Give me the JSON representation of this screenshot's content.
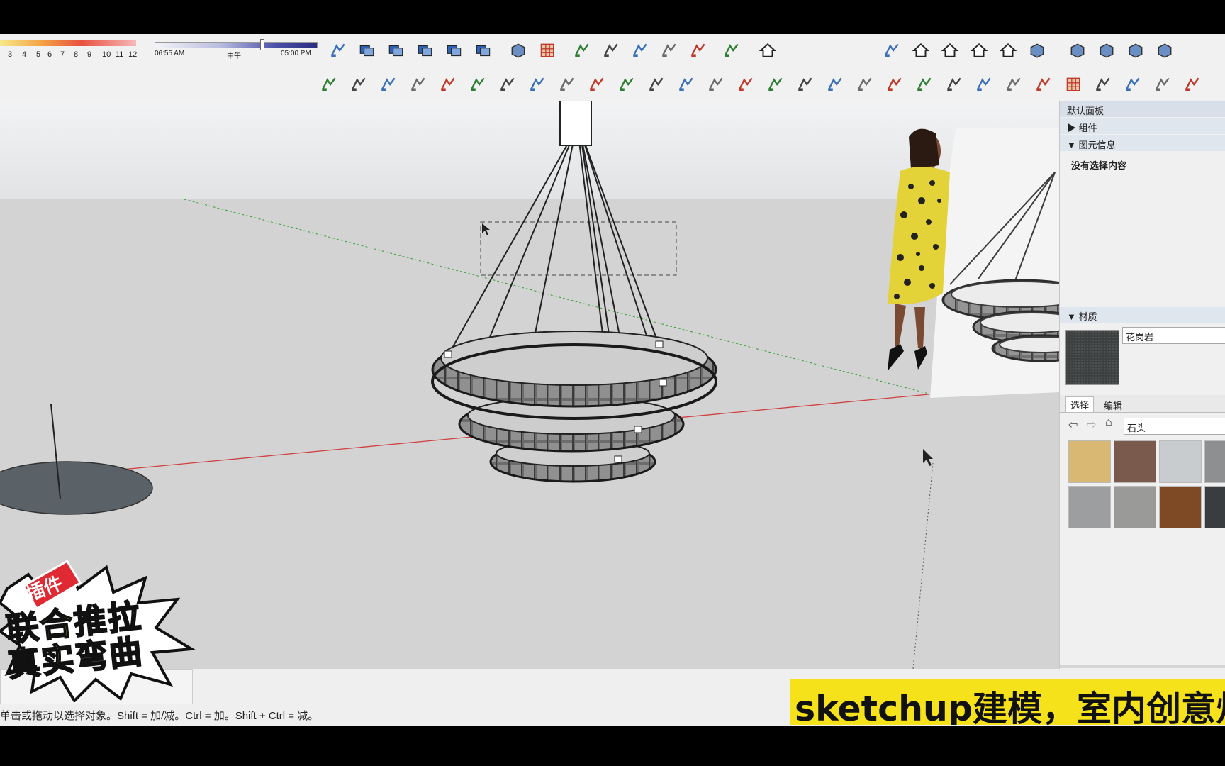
{
  "toolbar": {
    "shadow_scale_numbers": [
      "3",
      "4",
      "5",
      "6",
      "7",
      "8",
      "9",
      "10",
      "11",
      "12"
    ],
    "time_start": "06:55 AM",
    "time_noon": "中午",
    "time_end": "05:00 PM",
    "icons_row1": [
      "cube-view-icon",
      "layers-icon",
      "layers-icon",
      "layers-icon",
      "layers-icon",
      "layers-icon",
      "sandbox-icon",
      "grid-icon",
      "stamp-icon",
      "drape-icon",
      "smoove-icon",
      "add-detail-icon",
      "flip-edge-icon",
      "curve-icon",
      "house-icon",
      "door-icon",
      "home-icon",
      "home-icon",
      "home-icon",
      "home-icon",
      "box-icon",
      "box-icon",
      "box-icon",
      "box-icon",
      "box-icon"
    ],
    "icons_row2": [
      "follow-me-icon",
      "column-icon",
      "line-icon",
      "stairs-icon",
      "pushpull-icon",
      "dimension-icon",
      "bend-icon",
      "bend-icon",
      "arc-icon",
      "rotate-icon",
      "curve-icon",
      "slab-icon",
      "spiral-icon",
      "flip-icon",
      "flip-icon",
      "door-icon",
      "stamp-icon",
      "arch-icon",
      "chain-icon",
      "wave-icon",
      "spring-icon",
      "slice-icon",
      "comb-icon",
      "comb-icon",
      "mirror-icon",
      "grid-dots-icon",
      "panel-icon",
      "pen-icon",
      "knife-icon",
      "tablet-icon"
    ]
  },
  "tray": {
    "title": "默认面板",
    "components_label": "组件",
    "entity_info_label": "图元信息",
    "no_selection": "没有选择内容",
    "materials_label": "材质",
    "material_name": "花岗岩",
    "tab_select": "选择",
    "tab_edit": "编辑",
    "library": "石头",
    "swatch_colors": [
      "#d9b873",
      "#7a5a4c",
      "#c9ccce",
      "#8d8f90",
      "#9c9e9f",
      "#9a9a99",
      "#7e4a25",
      "#3a3d3f"
    ]
  },
  "status": {
    "hint": "单击或拖动以选择对象。Shift = 加/减。Ctrl = 加。Shift + Ctrl = 减。"
  },
  "overlay": {
    "badge_top": "插件",
    "badge_line1": "联合推拉",
    "badge_line2": "真实弯曲",
    "caption": "sketchup建模，室内创意灯"
  }
}
